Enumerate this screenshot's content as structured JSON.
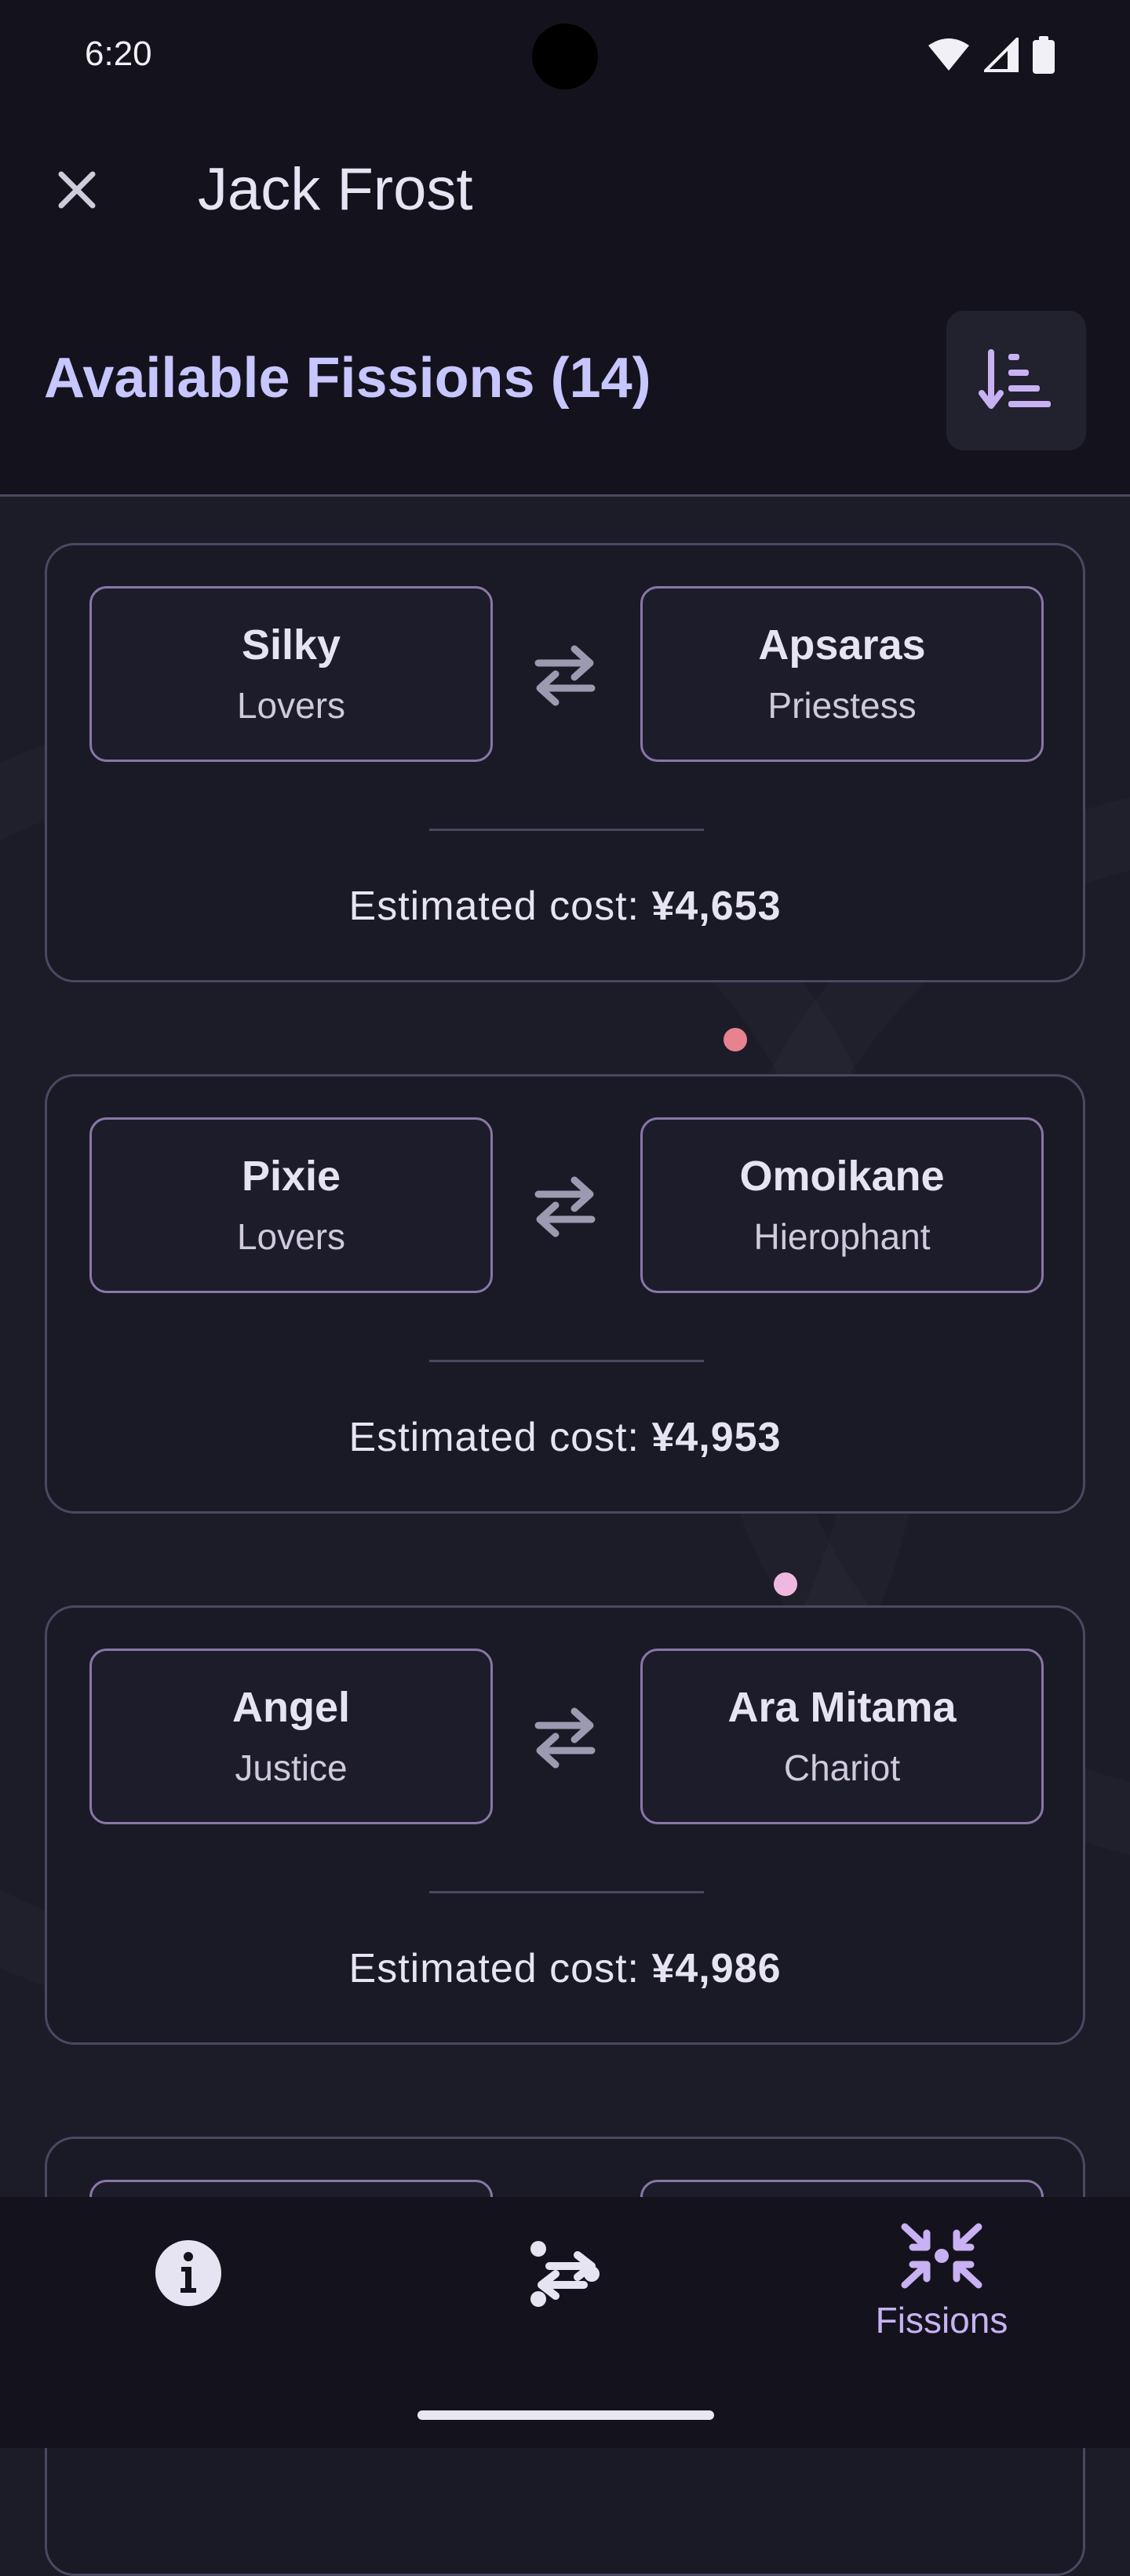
{
  "status_bar": {
    "time": "6:20",
    "icons": [
      "wifi-icon",
      "signal-icon",
      "battery-icon"
    ]
  },
  "app_bar": {
    "title": "Jack Frost",
    "close_icon": "close-icon"
  },
  "section": {
    "title": "Available Fissions (14)",
    "sort_icon": "sort-descending-icon"
  },
  "cost_label": "Estimated cost: ",
  "fissions": [
    {
      "left": {
        "name": "Silky",
        "arcana": "Lovers"
      },
      "right": {
        "name": "Apsaras",
        "arcana": "Priestess"
      },
      "cost": "¥4,653"
    },
    {
      "left": {
        "name": "Pixie",
        "arcana": "Lovers"
      },
      "right": {
        "name": "Omoikane",
        "arcana": "Hierophant"
      },
      "cost": "¥4,953"
    },
    {
      "left": {
        "name": "Angel",
        "arcana": "Justice"
      },
      "right": {
        "name": "Ara Mitama",
        "arcana": "Chariot"
      },
      "cost": "¥4,986"
    },
    {
      "left": {
        "name": "",
        "arcana": ""
      },
      "right": {
        "name": "",
        "arcana": ""
      },
      "cost": ""
    }
  ],
  "bottom_nav": {
    "items": [
      {
        "icon": "info-icon",
        "label": ""
      },
      {
        "icon": "fusion-icon",
        "label": ""
      },
      {
        "icon": "fission-icon",
        "label": "Fissions",
        "selected": true
      }
    ]
  },
  "colors": {
    "background": "#1c1b28",
    "surface": "#14131d",
    "accent": "#c8c6ff",
    "selected_nav": "#c8b2f3",
    "card_border": "#4a4862",
    "demon_border": "#8a76a7"
  }
}
